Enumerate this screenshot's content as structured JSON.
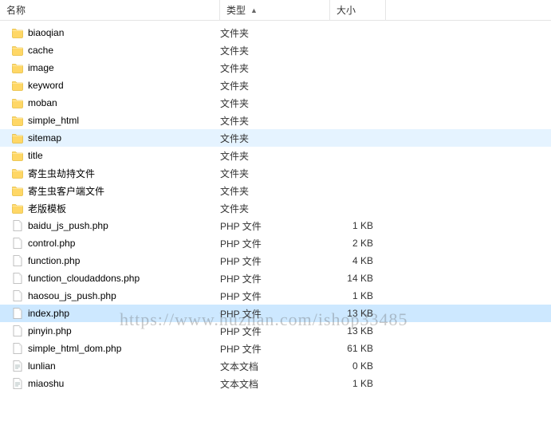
{
  "columns": {
    "name": "名称",
    "type": "类型",
    "size": "大小"
  },
  "sort_indicator": "▲",
  "watermark": "https://www.huzhan.com/ishop33485",
  "rows": [
    {
      "icon": "folder",
      "name": "biaoqian",
      "type": "文件夹",
      "size": "",
      "state": ""
    },
    {
      "icon": "folder",
      "name": "cache",
      "type": "文件夹",
      "size": "",
      "state": ""
    },
    {
      "icon": "folder",
      "name": "image",
      "type": "文件夹",
      "size": "",
      "state": ""
    },
    {
      "icon": "folder",
      "name": "keyword",
      "type": "文件夹",
      "size": "",
      "state": ""
    },
    {
      "icon": "folder",
      "name": "moban",
      "type": "文件夹",
      "size": "",
      "state": ""
    },
    {
      "icon": "folder",
      "name": "simple_html",
      "type": "文件夹",
      "size": "",
      "state": ""
    },
    {
      "icon": "folder",
      "name": "sitemap",
      "type": "文件夹",
      "size": "",
      "state": "highlight"
    },
    {
      "icon": "folder",
      "name": "title",
      "type": "文件夹",
      "size": "",
      "state": ""
    },
    {
      "icon": "folder",
      "name": "寄生虫劫持文件",
      "type": "文件夹",
      "size": "",
      "state": ""
    },
    {
      "icon": "folder",
      "name": "寄生虫客户端文件",
      "type": "文件夹",
      "size": "",
      "state": ""
    },
    {
      "icon": "folder",
      "name": "老版模板",
      "type": "文件夹",
      "size": "",
      "state": ""
    },
    {
      "icon": "php",
      "name": "baidu_js_push.php",
      "type": "PHP 文件",
      "size": "1 KB",
      "state": ""
    },
    {
      "icon": "php",
      "name": "control.php",
      "type": "PHP 文件",
      "size": "2 KB",
      "state": ""
    },
    {
      "icon": "php",
      "name": "function.php",
      "type": "PHP 文件",
      "size": "4 KB",
      "state": ""
    },
    {
      "icon": "php",
      "name": "function_cloudaddons.php",
      "type": "PHP 文件",
      "size": "14 KB",
      "state": ""
    },
    {
      "icon": "php",
      "name": "haosou_js_push.php",
      "type": "PHP 文件",
      "size": "1 KB",
      "state": ""
    },
    {
      "icon": "php",
      "name": "index.php",
      "type": "PHP 文件",
      "size": "13 KB",
      "state": "selected"
    },
    {
      "icon": "php",
      "name": "pinyin.php",
      "type": "PHP 文件",
      "size": "13 KB",
      "state": ""
    },
    {
      "icon": "php",
      "name": "simple_html_dom.php",
      "type": "PHP 文件",
      "size": "61 KB",
      "state": ""
    },
    {
      "icon": "text",
      "name": "lunlian",
      "type": "文本文档",
      "size": "0 KB",
      "state": ""
    },
    {
      "icon": "text",
      "name": "miaoshu",
      "type": "文本文档",
      "size": "1 KB",
      "state": ""
    }
  ]
}
